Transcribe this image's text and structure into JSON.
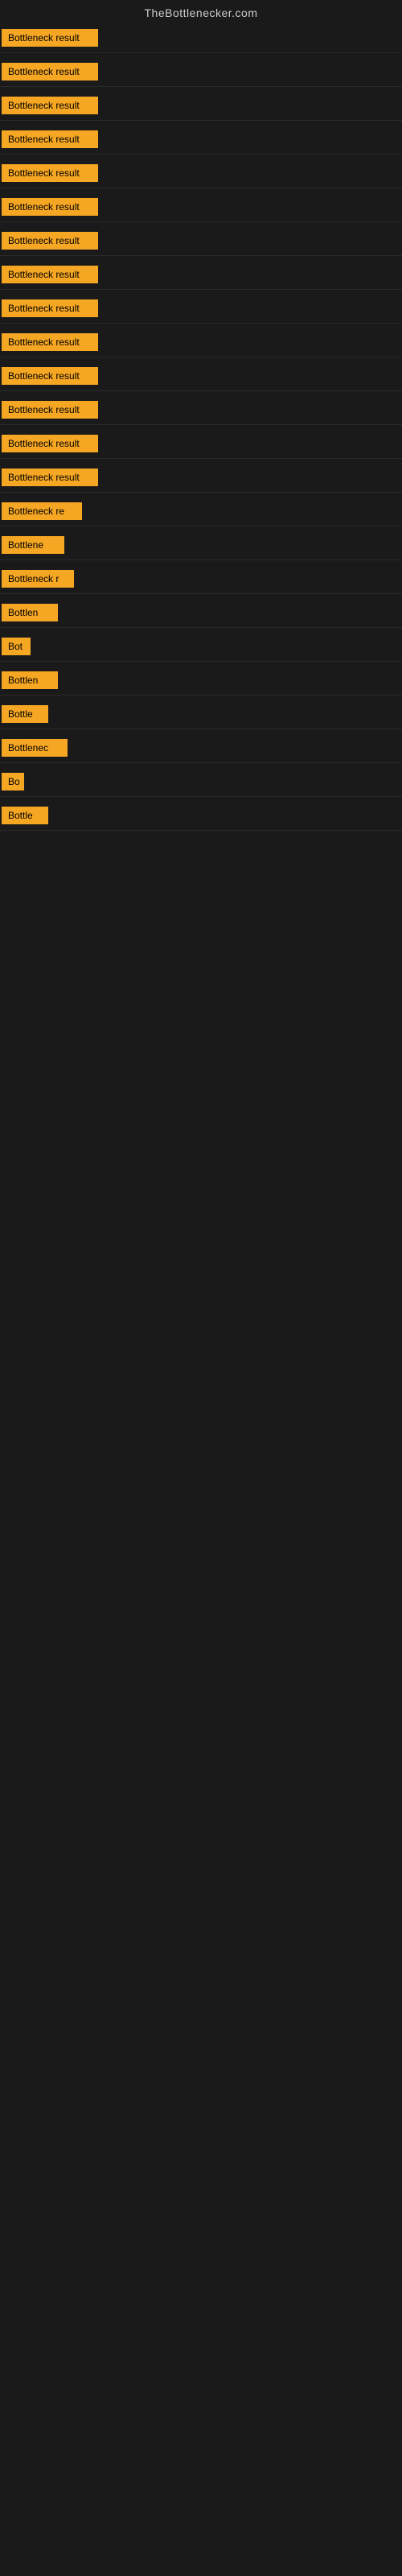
{
  "site": {
    "title": "TheBottlenecker.com"
  },
  "items": [
    {
      "id": 1,
      "label": "Bottleneck result",
      "width": 120
    },
    {
      "id": 2,
      "label": "Bottleneck result",
      "width": 120
    },
    {
      "id": 3,
      "label": "Bottleneck result",
      "width": 120
    },
    {
      "id": 4,
      "label": "Bottleneck result",
      "width": 120
    },
    {
      "id": 5,
      "label": "Bottleneck result",
      "width": 120
    },
    {
      "id": 6,
      "label": "Bottleneck result",
      "width": 120
    },
    {
      "id": 7,
      "label": "Bottleneck result",
      "width": 120
    },
    {
      "id": 8,
      "label": "Bottleneck result",
      "width": 120
    },
    {
      "id": 9,
      "label": "Bottleneck result",
      "width": 120
    },
    {
      "id": 10,
      "label": "Bottleneck result",
      "width": 120
    },
    {
      "id": 11,
      "label": "Bottleneck result",
      "width": 120
    },
    {
      "id": 12,
      "label": "Bottleneck result",
      "width": 120
    },
    {
      "id": 13,
      "label": "Bottleneck result",
      "width": 120
    },
    {
      "id": 14,
      "label": "Bottleneck result",
      "width": 120
    },
    {
      "id": 15,
      "label": "Bottleneck re",
      "width": 100
    },
    {
      "id": 16,
      "label": "Bottlene",
      "width": 78
    },
    {
      "id": 17,
      "label": "Bottleneck r",
      "width": 90
    },
    {
      "id": 18,
      "label": "Bottlen",
      "width": 70
    },
    {
      "id": 19,
      "label": "Bot",
      "width": 36
    },
    {
      "id": 20,
      "label": "Bottlen",
      "width": 70
    },
    {
      "id": 21,
      "label": "Bottle",
      "width": 58
    },
    {
      "id": 22,
      "label": "Bottlenec",
      "width": 82
    },
    {
      "id": 23,
      "label": "Bo",
      "width": 28
    },
    {
      "id": 24,
      "label": "Bottle",
      "width": 58
    }
  ],
  "colors": {
    "background": "#1a1a1a",
    "badge_bg": "#f5a623",
    "badge_text": "#000000",
    "title_text": "#cccccc",
    "divider": "#2a2a2a"
  }
}
